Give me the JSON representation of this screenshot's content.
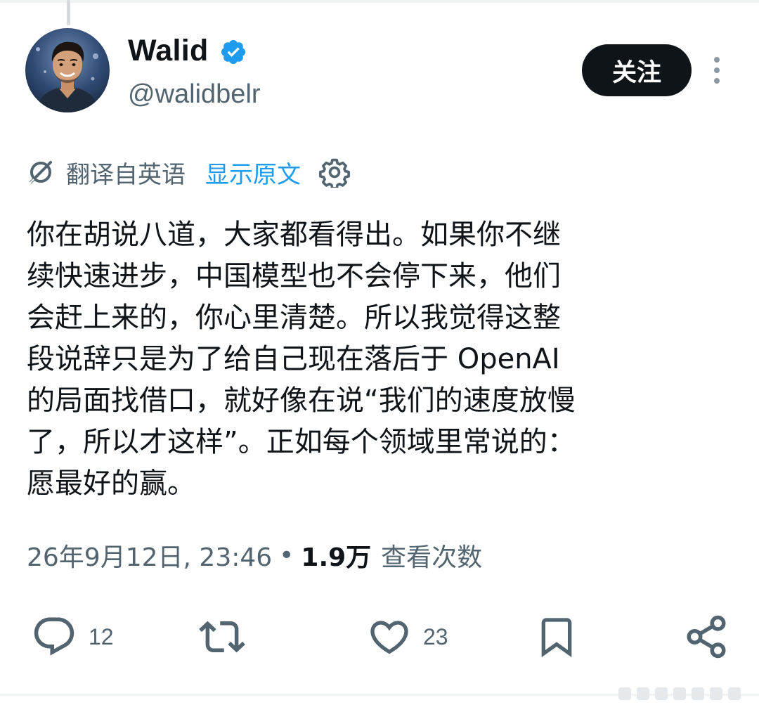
{
  "author": {
    "name": "Walid",
    "handle": "@walidbelr",
    "verified": true,
    "avatar": "avatar-photo"
  },
  "header": {
    "follow_label": "关注",
    "more_icon": "more-vertical-icon"
  },
  "translation": {
    "label": "翻译自英语",
    "show_original_label": "显示原文",
    "icon": "translate-icon",
    "settings_icon": "gear-icon"
  },
  "tweet": {
    "text": "你在胡说八道，大家都看得出。如果你不继\n续快速进步，中国模型也不会停下来，他们\n会赶上来的，你心里清楚。所以我觉得这整\n段说辞只是为了给自己现在落后于 OpenAI\n的局面找借口，就好像在说“我们的速度放慢\n了，所以才这样”。正如每个领域里常说的：\n愿最好的赢。"
  },
  "meta": {
    "timestamp": "26年9月12日, 23:46",
    "separator": "•",
    "views_count": "1.9万",
    "views_label": "查看次数"
  },
  "actions": {
    "reply_count": "12",
    "retweet_count": "",
    "like_count": "23",
    "bookmark_count": "",
    "share_count": ""
  },
  "colors": {
    "text": "#0f1419",
    "secondary": "#536471",
    "link": "#1d9bf0",
    "verified": "#1d9bf0",
    "border": "#eff3f4"
  }
}
